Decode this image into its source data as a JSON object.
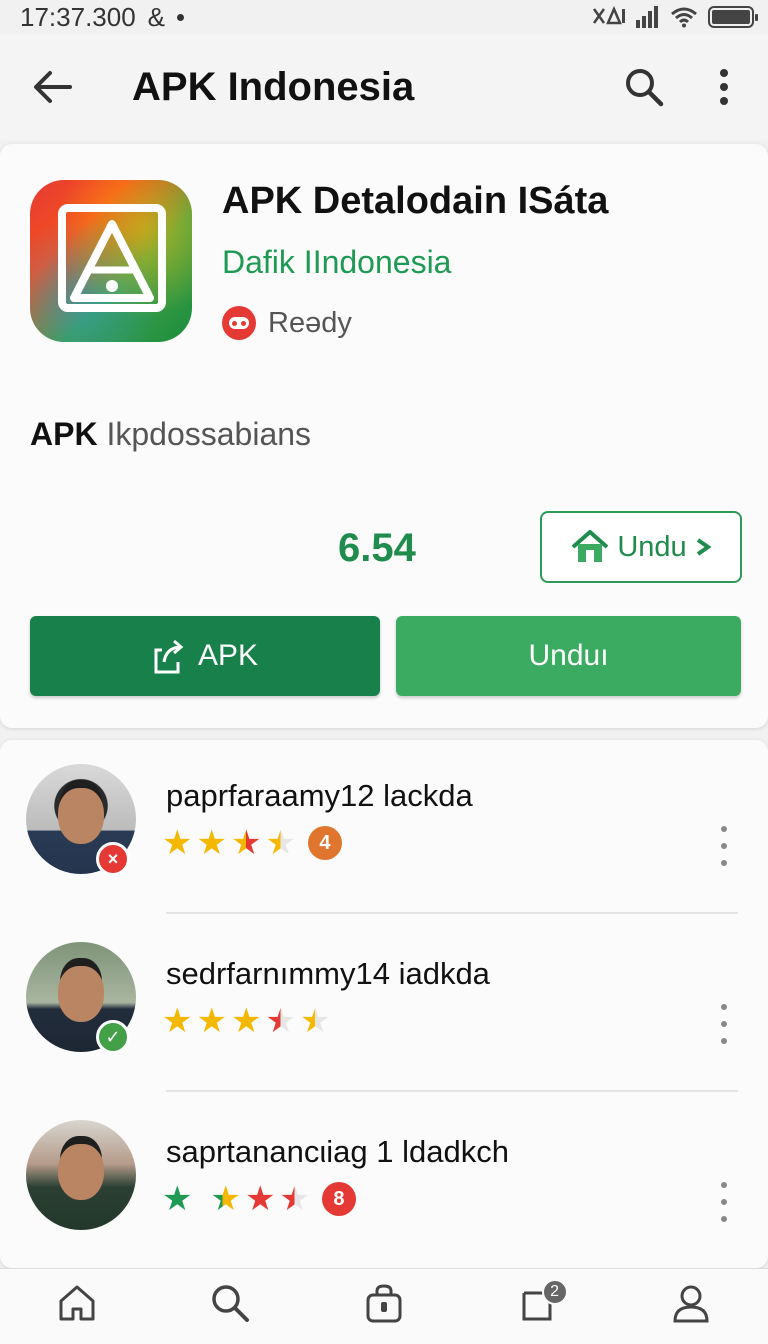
{
  "status_bar": {
    "time": "17:37.300",
    "extra": "&",
    "signal_text": "&#x2715;&#x2571;",
    "icons": [
      "no-sim-icon",
      "signal-icon",
      "wifi-icon",
      "battery-icon"
    ]
  },
  "app_bar": {
    "title": "APK Indonesia",
    "icons": [
      "back-arrow-icon",
      "search-icon",
      "more-vert-icon"
    ]
  },
  "app": {
    "name": "APK Detalodain ISáta",
    "developer": "Dafik IIndonesia",
    "status": "Reǝdy",
    "section_prefix": "APK",
    "section_rest": " Ikpdossabians",
    "version": "6.54",
    "outline_button": "Undu",
    "primary_button": "APK",
    "secondary_button": "Unduı"
  },
  "reviews": [
    {
      "name": "paprfaraamy12 lackda",
      "badge": "×",
      "rating_badge": "4",
      "rating_color": "#e0752d"
    },
    {
      "name": "sedrfarnımmy14 iadkda",
      "badge": "✓",
      "rating_badge": "",
      "rating_color": ""
    },
    {
      "name": "saprtanancιiag 1 ldadkch",
      "badge": "",
      "rating_badge": "8",
      "rating_color": "#e53935"
    }
  ],
  "bottom_nav": {
    "items": [
      "home-icon",
      "search-icon",
      "bag-icon",
      "notifications-icon",
      "profile-icon"
    ],
    "notification_count": "2"
  },
  "colors": {
    "brand_green": "#1f8b4c",
    "button_dark_green": "#18804a",
    "button_light_green": "#3bab61",
    "star_gold": "#f5b800",
    "status_red": "#e53935"
  }
}
